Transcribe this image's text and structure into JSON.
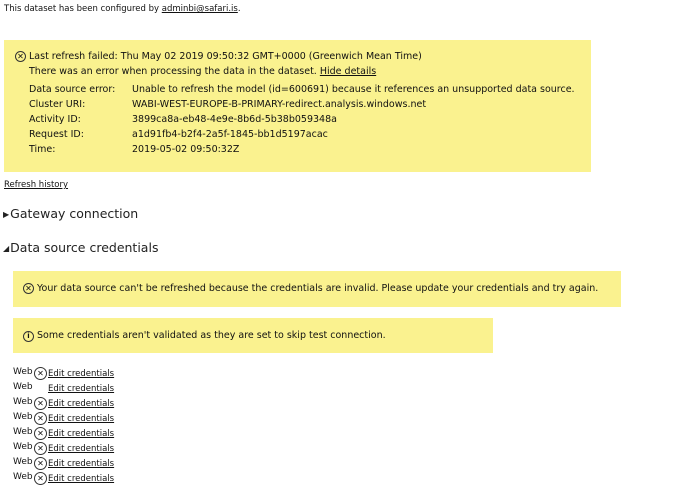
{
  "configured": {
    "prefix": "This dataset has been configured by ",
    "user": "adminbi@safari.is",
    "suffix": "."
  },
  "refresh_error": {
    "title": "Last refresh failed: Thu May 02 2019 09:50:32 GMT+0000 (Greenwich Mean Time)",
    "message": "There was an error when processing the data in the dataset.",
    "hide_details": "Hide details",
    "details": [
      {
        "label": "Data source error:",
        "value": "Unable to refresh the model (id=600691) because it references an unsupported data source."
      },
      {
        "label": "Cluster URI:",
        "value": "WABI-WEST-EUROPE-B-PRIMARY-redirect.analysis.windows.net"
      },
      {
        "label": "Activity ID:",
        "value": "3899ca8a-eb48-4e9e-8b6d-5b38b059348a"
      },
      {
        "label": "Request ID:",
        "value": "a1d91fb4-b2f4-2a5f-1845-bb1d5197acac"
      },
      {
        "label": "Time:",
        "value": "2019-05-02 09:50:32Z"
      }
    ]
  },
  "refresh_history": "Refresh history",
  "gateway": {
    "label": "Gateway connection",
    "expanded": false
  },
  "credentials": {
    "label": "Data source credentials",
    "expanded": true,
    "invalid_banner": "Your data source can't be refreshed because the credentials are invalid. Please update your credentials and try again.",
    "skip_banner": "Some credentials aren't validated as they are set to skip test connection.",
    "sources": [
      {
        "type": "Web",
        "status": "error",
        "link": "Edit credentials"
      },
      {
        "type": "Web",
        "status": "ok",
        "link": "Edit credentials"
      },
      {
        "type": "Web",
        "status": "error",
        "link": "Edit credentials"
      },
      {
        "type": "Web",
        "status": "error",
        "link": "Edit credentials"
      },
      {
        "type": "Web",
        "status": "error",
        "link": "Edit credentials"
      },
      {
        "type": "Web",
        "status": "error",
        "link": "Edit credentials"
      },
      {
        "type": "Web",
        "status": "error",
        "link": "Edit credentials"
      },
      {
        "type": "Web",
        "status": "error",
        "link": "Edit credentials"
      }
    ]
  },
  "colors": {
    "warning_background": "#faf28f"
  }
}
